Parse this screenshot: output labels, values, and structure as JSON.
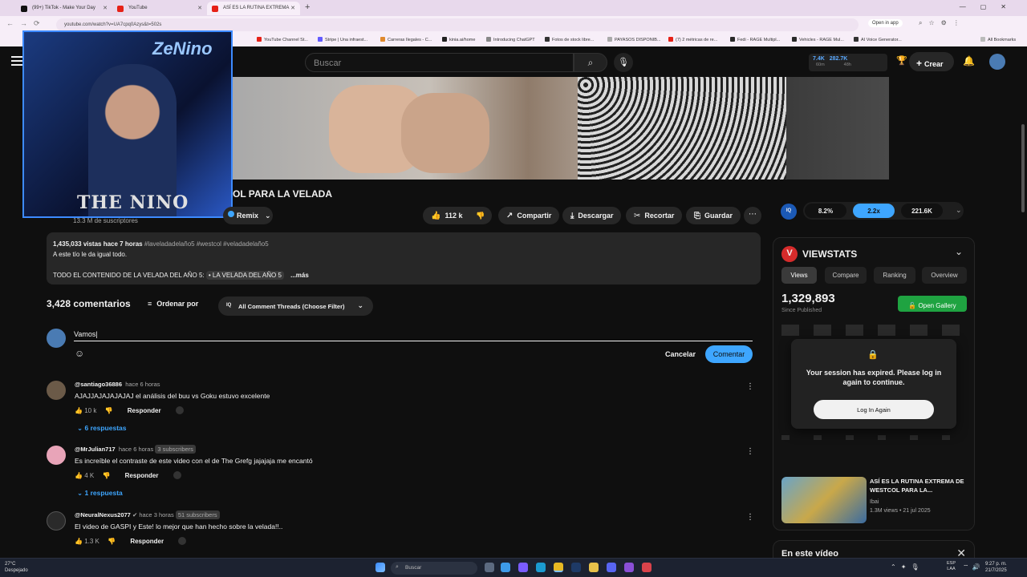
{
  "browser": {
    "tabs": [
      {
        "label": "(99+) TikTok - Make Your Day",
        "color": "#111111"
      },
      {
        "label": "YouTube",
        "color": "#e62117"
      },
      {
        "label": "ASÍ ES LA RUTINA EXTREMA",
        "color": "#e62117"
      }
    ],
    "url": "youtube.com/watch?v=UA7cpq0Azys&t=502s",
    "open_in_app": "Open in app",
    "bookmarks": [
      "YouTube Channel St...",
      "Stripe | Una infraest...",
      "Carreras Ilegales - C...",
      "kinia.ai/home",
      "Introducing ChatGPT",
      "Fotos de stock libre...",
      "PAYASOS DISPONIB...",
      "(7) 2 métricas de re...",
      "Fedi - RAGE Multipl...",
      "Vehicles - RAGE Mul...",
      "AI Voice Generator...",
      "All Bookmarks"
    ]
  },
  "youtube": {
    "search_placeholder": "Buscar",
    "stats_views": "7.4K",
    "stats_views_unit": "60m",
    "stats_subs": "282.7K",
    "stats_subs_unit": "48h",
    "create_label": "Crear",
    "accent": "#3ea6ff"
  },
  "webcam": {
    "neon_text": "ZeNino",
    "logo_text": "THE NINO"
  },
  "video": {
    "title_visible": "OL PARA LA VELADA",
    "subscribers": "13.3 M de suscriptores",
    "remix_label": "Remix",
    "likes": "112 k",
    "share_label": "Compartir",
    "download_label": "Descargar",
    "clip_label": "Recortar",
    "save_label": "Guardar"
  },
  "description": {
    "meta": "1,435,033 vistas  hace 7 horas",
    "tags": "#laveladadelaño5 #westcol #veladadelaño5",
    "line1": "A este tío le da igual todo.",
    "line2_prefix": "TODO EL CONTENIDO DE LA VELADA DEL AÑO 5:",
    "line2_chip": "• LA VELADA DEL AÑO 5",
    "more": "...más"
  },
  "comments_section": {
    "count": "3,428 comentarios",
    "sort_label": "Ordenar por",
    "filter_label": "All Comment Threads (Choose Filter)",
    "filter_badge": "IQ",
    "input_value": "Vamos|",
    "cancel_label": "Cancelar",
    "submit_label": "Comentar",
    "reply_label": "Responder",
    "comments": [
      {
        "author": "@santiago36886",
        "time": "hace 6 horas",
        "badge": "",
        "text": "AJAJJAJAJAJAJAJ el análisis del buu vs Goku estuvo excelente",
        "likes": "10 k",
        "replies": "6 respuestas",
        "avatar_color": "#6b5a48"
      },
      {
        "author": "@MrJulian717",
        "time": "hace 6 horas",
        "badge": "3 subscribers",
        "text": "Es increíble el contraste de este video con el de The Grefg jajajaja me encantó",
        "likes": "4 K",
        "replies": "1 respuesta",
        "avatar_color": "#e8a4b8"
      },
      {
        "author": "@NeuralNexus2077",
        "time": "hace 3 horas",
        "badge": "51 subscribers",
        "text": "El video de GASPI y Este! lo mejor que han hecho sobre la velada!!..",
        "likes": "1.3 K",
        "replies": "",
        "avatar_color": "#2a2a2a"
      }
    ]
  },
  "sidebar": {
    "iq_logo": "IQ",
    "iq_values": [
      "8.2%",
      "2.2x",
      "221.6K"
    ],
    "viewstats_logo": "V",
    "viewstats_title": "VIEWSTATS",
    "tabs": [
      "Views",
      "Compare",
      "Ranking",
      "Overview"
    ],
    "views": "1,329,893",
    "since": "Since Published",
    "gallery_label": "Open Gallery",
    "expired_msg": "Your session has expired. Please log in again to continue.",
    "login_label": "Log In Again",
    "related": {
      "title": "ASÍ ES LA RUTINA EXTREMA DE WESTCOL PARA LA...",
      "channel": "Ibai",
      "meta": "1.3M views • 21 jul 2025"
    },
    "en_este_video": "En este vídeo"
  },
  "taskbar": {
    "temp": "27°C",
    "weather": "Despejado",
    "search_placeholder": "Buscar",
    "lang": "ESP",
    "region": "LAA",
    "time": "9:27 p. m.",
    "date": "21/7/2025"
  }
}
